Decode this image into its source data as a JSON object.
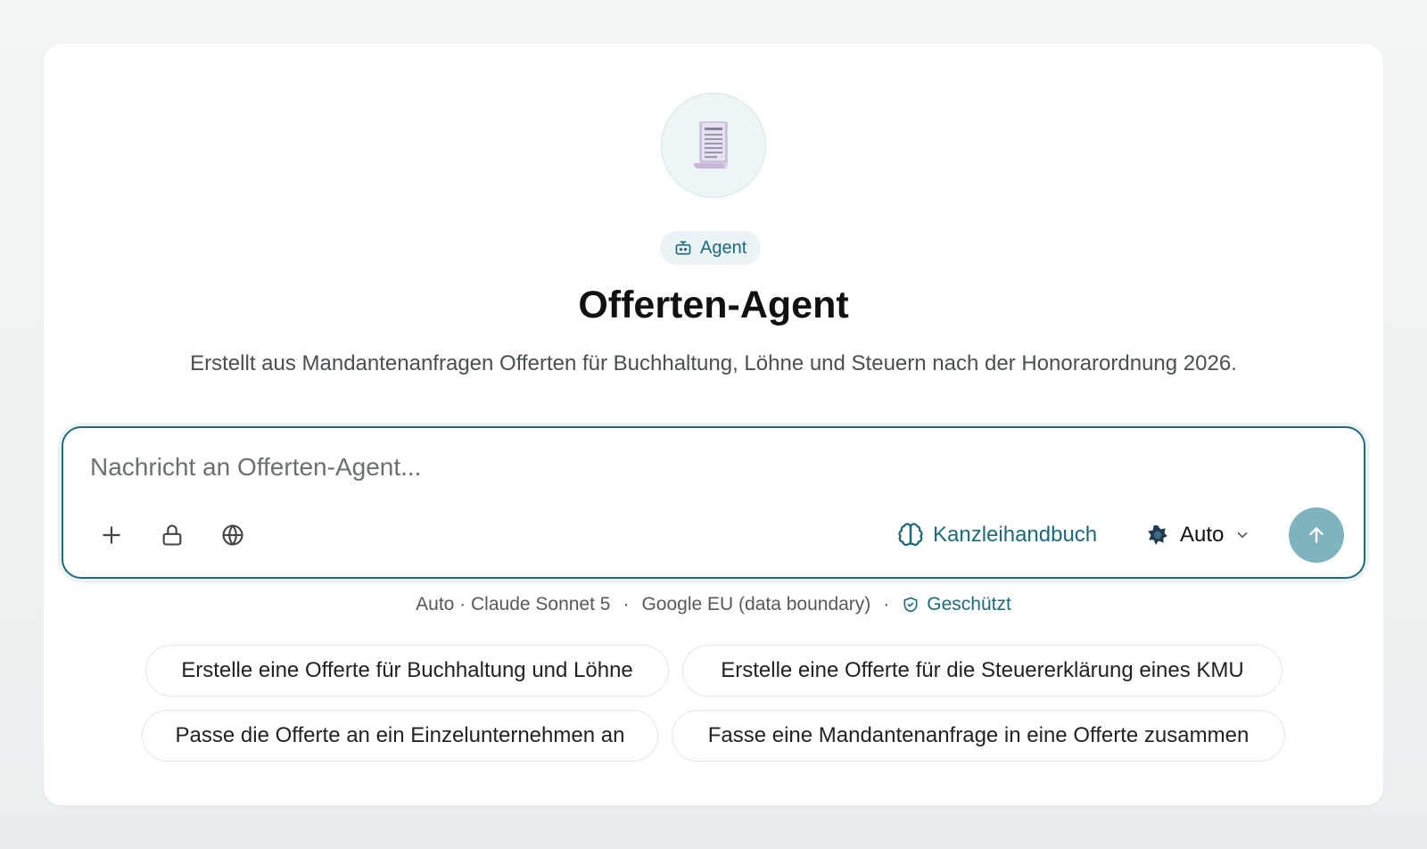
{
  "agent": {
    "avatar_icon": "receipt-icon",
    "badge_icon": "robot-icon",
    "badge_label": "Agent",
    "name": "Offerten-Agent",
    "description": "Erstellt aus Mandantenanfragen Offerten für Buchhaltung, Löhne und Steuern nach der Honorarordnung 2026."
  },
  "composer": {
    "placeholder": "Nachricht an Offerten-Agent...",
    "value": "",
    "tools": [
      "plus-icon",
      "lock-icon",
      "globe-icon"
    ],
    "knowledge_label": "Kanzleihandbuch",
    "model_label": "Auto",
    "send_icon": "arrow-up-icon"
  },
  "meta": {
    "model": "Auto · Claude Sonnet 5",
    "separator": "·",
    "region": "Google EU (data boundary)",
    "protected": "Geschützt"
  },
  "suggestions": [
    "Erstelle eine Offerte für Buchhaltung und Löhne",
    "Erstelle eine Offerte für die Steuererklärung eines KMU",
    "Passe die Offerte an ein Einzelunternehmen an",
    "Fasse eine Mandantenanfrage in eine Offerte zusammen"
  ],
  "colors": {
    "accent": "#1d6a7a",
    "send_button": "#7fb4bf"
  }
}
